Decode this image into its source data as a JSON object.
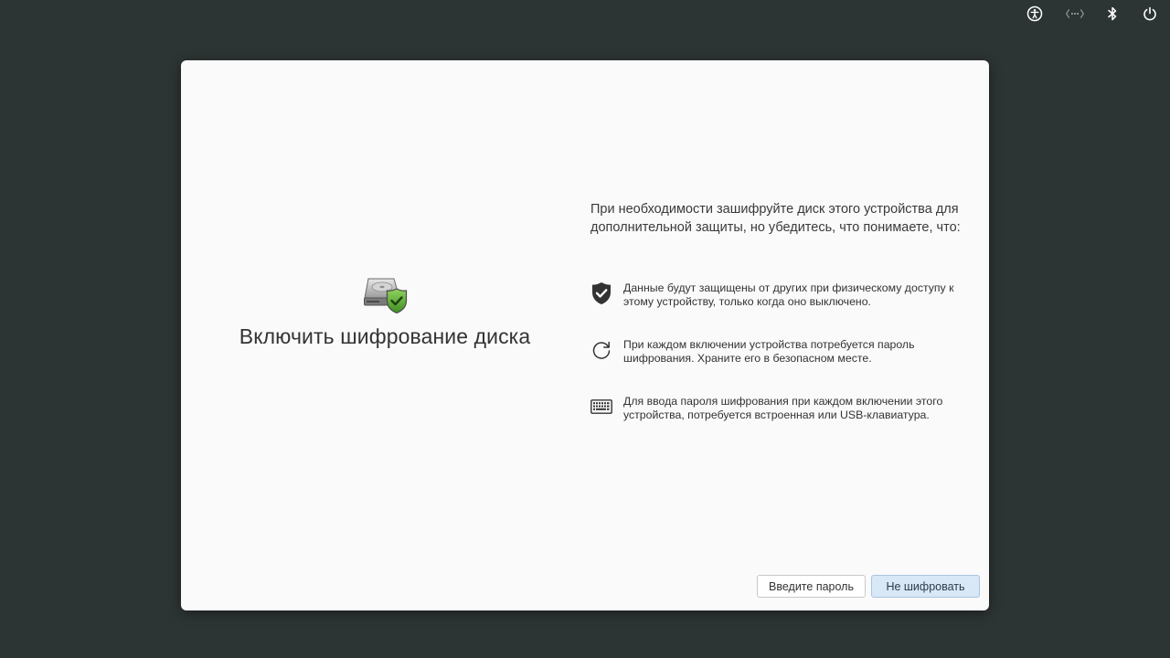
{
  "topbar": {
    "icons": [
      "accessibility-icon",
      "network-icon",
      "bluetooth-icon",
      "power-icon"
    ]
  },
  "dialog": {
    "title": "Включить шифрование диска",
    "intro": "При необходимости зашифруйте диск этого устройства для дополнительной защиты, но убедитесь, что понимаете, что:",
    "points": [
      {
        "icon": "shield-check-icon",
        "text": "Данные будут защищены от других при физическому доступу к этому устройству, только когда оно выключено."
      },
      {
        "icon": "refresh-icon",
        "text": "При каждом включении устройства потребуется пароль шифрования. Храните его в безопасном месте."
      },
      {
        "icon": "keyboard-icon",
        "text": "Для ввода пароля шифрования при каждом включении этого устройства, потребуется встроенная или USB-клавиатура."
      }
    ],
    "buttons": {
      "enter_password": "Введите пароль",
      "dont_encrypt": "Не шифровать"
    }
  },
  "colors": {
    "desktop_background": "#2d3534",
    "dialog_background": "#fafafa",
    "primary_button": "#d8e8f7",
    "shield_green": "#5fb33a"
  }
}
